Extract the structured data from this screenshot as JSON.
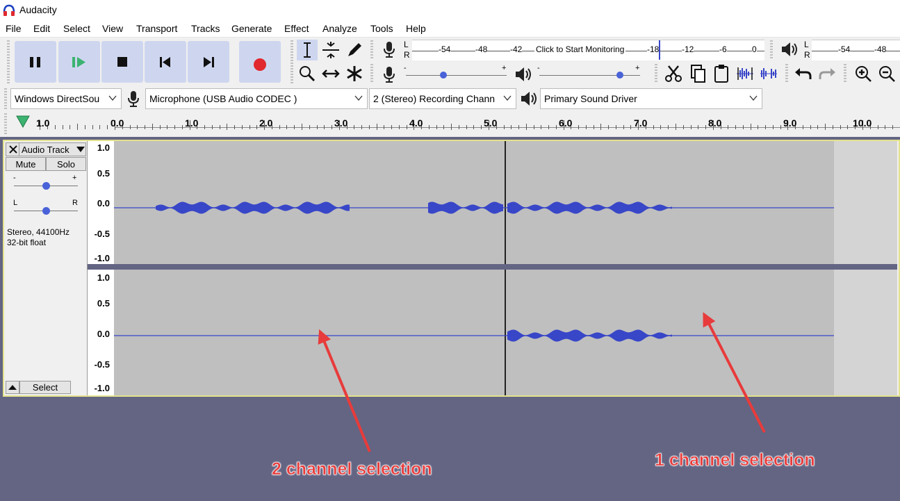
{
  "window": {
    "title": "Audacity"
  },
  "menu": [
    "File",
    "Edit",
    "Select",
    "View",
    "Transport",
    "Tracks",
    "Generate",
    "Effect",
    "Analyze",
    "Tools",
    "Help"
  ],
  "meters": {
    "rec_lr": {
      "l": "L",
      "r": "R"
    },
    "rec_scale": [
      "-54",
      "-48",
      "-42",
      "-18",
      "-12",
      "-6",
      "0"
    ],
    "rec_prompt": "Click to Start Monitoring",
    "play_lr": {
      "l": "L",
      "r": "R"
    },
    "play_scale": [
      "-54",
      "-48"
    ],
    "mixer_minus": "-",
    "mixer_plus": "+"
  },
  "device": {
    "host": "Windows DirectSou",
    "input": "Microphone (USB Audio CODEC )",
    "channels": "2 (Stereo) Recording Chann",
    "output": "Primary Sound Driver"
  },
  "ruler": {
    "labels": [
      "1.0",
      "0.0",
      "1.0",
      "2.0",
      "3.0",
      "4.0",
      "5.0",
      "6.0",
      "7.0",
      "8.0",
      "9.0",
      "10.0"
    ]
  },
  "track": {
    "name": "Audio Track",
    "mute": "Mute",
    "solo": "Solo",
    "gain_minus": "-",
    "gain_plus": "+",
    "pan_l": "L",
    "pan_r": "R",
    "info_line1": "Stereo, 44100Hz",
    "info_line2": "32-bit float",
    "select": "Select",
    "gain_level": 0.5,
    "pan_level": 0.5,
    "scale": [
      "1.0",
      "0.5",
      "0.0",
      "-0.5",
      "-1.0"
    ]
  },
  "annotations": {
    "two_channel": "2 channel selection",
    "one_channel": "1 channel selection"
  },
  "colors": {
    "record": "#e0282e",
    "wave": "#3846c8",
    "play_green": "#3cb371",
    "background": "#636583",
    "arrow": "#e83b3b"
  }
}
